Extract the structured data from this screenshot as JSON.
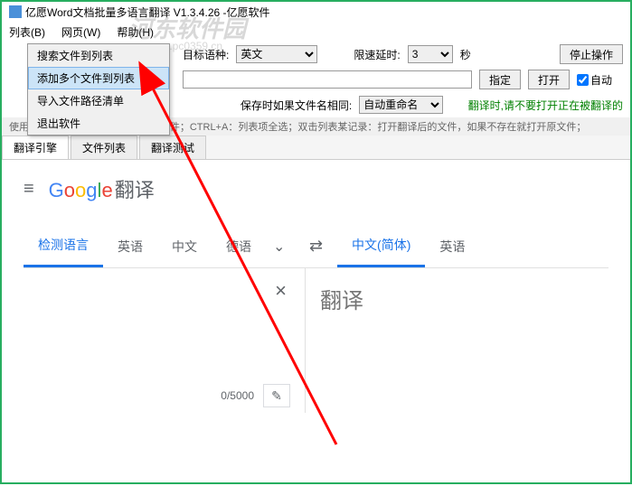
{
  "titlebar": {
    "text": "亿愿Word文档批量多语言翻译 V1.3.4.26 -亿愿软件"
  },
  "watermark": {
    "main": "河东软件园",
    "sub": "www.pc0359.cn"
  },
  "menubar": {
    "list": "列表(B)",
    "webpage": "网页(W)",
    "help": "帮助(H)"
  },
  "dropdown": {
    "items": [
      "搜索文件到列表",
      "添加多个文件到列表",
      "导入文件路径清单",
      "退出软件"
    ]
  },
  "toolbar": {
    "row1": {
      "target_lang_label": "目标语种:",
      "target_lang_value": "英文",
      "limit_label": "限速延时:",
      "limit_value": "3",
      "seconds": "秒",
      "stop_btn": "停止操作"
    },
    "row2": {
      "locate_btn": "指定",
      "open_btn": "打开",
      "auto_label": "自动"
    },
    "row3": {
      "save_label": "保存时如果文件名相同:",
      "save_value": "自动重命名",
      "warning": "翻译时,请不要打开正在被翻译的"
    },
    "hint": "使用快捷键提示：F4：翻译选中的文件；CTRL+A：列表项全选；双击列表某记录：打开翻译后的文件，如果不存在就打开原文件；"
  },
  "tabs": {
    "engine": "翻译引擎",
    "filelist": "文件列表",
    "test": "翻译测试"
  },
  "translate": {
    "brand_suffix": "翻译",
    "source_langs": {
      "detect": "检测语言",
      "english": "英语",
      "chinese": "中文",
      "german": "德语"
    },
    "target_langs": {
      "chinese_simp": "中文(简体)",
      "english": "英语"
    },
    "output_placeholder": "翻译",
    "char_count": "0/5000"
  }
}
